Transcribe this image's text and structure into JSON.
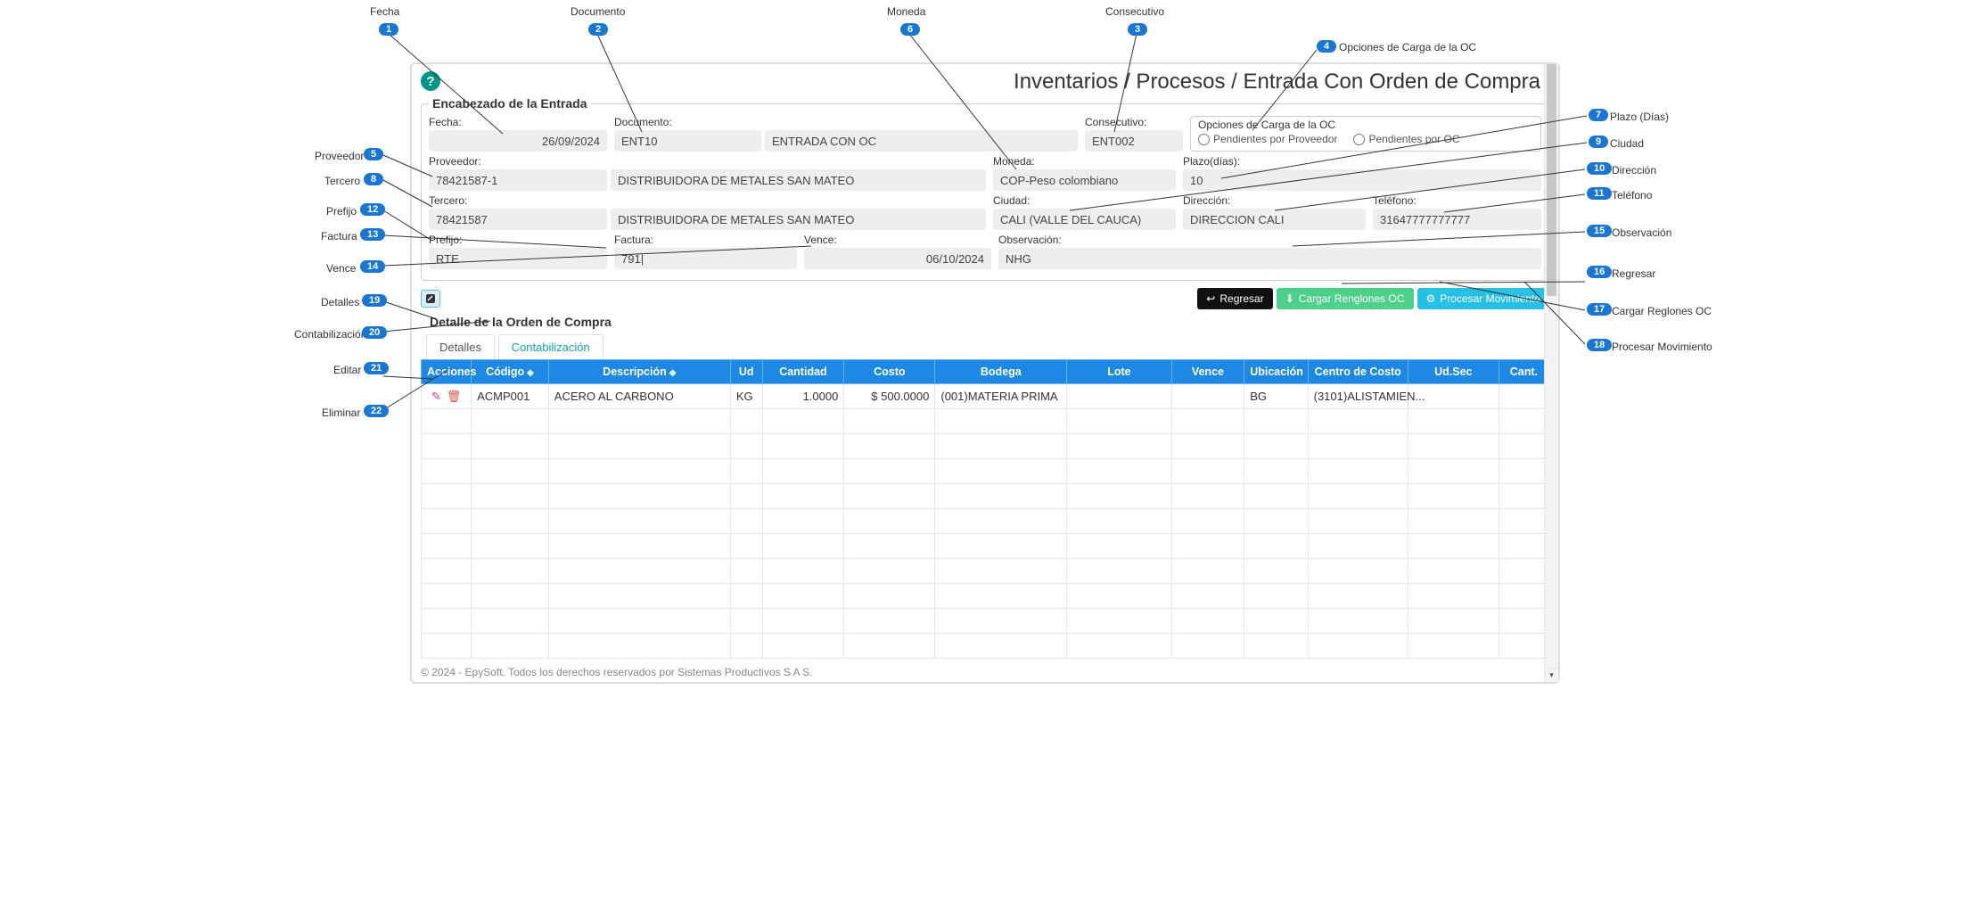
{
  "annotations": {
    "a1": {
      "num": "1",
      "label": "Fecha"
    },
    "a2": {
      "num": "2",
      "label": "Documento"
    },
    "a3": {
      "num": "3",
      "label": "Consecutivo"
    },
    "a4": {
      "num": "4",
      "label": "Opciones de Carga de la OC"
    },
    "a5": {
      "num": "5",
      "label": "Proveedor"
    },
    "a6": {
      "num": "6",
      "label": "Moneda"
    },
    "a7": {
      "num": "7",
      "label": "Plazo (Días)"
    },
    "a8": {
      "num": "8",
      "label": "Tercero"
    },
    "a9": {
      "num": "9",
      "label": "Ciudad"
    },
    "a10": {
      "num": "10",
      "label": "Dirección"
    },
    "a11": {
      "num": "11",
      "label": "Teléfono"
    },
    "a12": {
      "num": "12",
      "label": "Prefijo"
    },
    "a13": {
      "num": "13",
      "label": "Factura"
    },
    "a14": {
      "num": "14",
      "label": "Vence"
    },
    "a15": {
      "num": "15",
      "label": "Observación"
    },
    "a16": {
      "num": "16",
      "label": "Regresar"
    },
    "a17": {
      "num": "17",
      "label": "Cargar Reglones OC"
    },
    "a18": {
      "num": "18",
      "label": "Procesar Movimiento"
    },
    "a19": {
      "num": "19",
      "label": "Detalles"
    },
    "a20": {
      "num": "20",
      "label": "Contabilización"
    },
    "a21": {
      "num": "21",
      "label": "Editar"
    },
    "a22": {
      "num": "22",
      "label": "Eliminar"
    }
  },
  "breadcrumb": "Inventarios / Procesos / Entrada Con Orden de Compra",
  "header": {
    "legend": "Encabezado de la Entrada",
    "fecha": {
      "label": "Fecha:",
      "value": "26/09/2024"
    },
    "documento": {
      "label": "Documento:",
      "code": "ENT10",
      "desc": "ENTRADA CON OC"
    },
    "consecutivo": {
      "label": "Consecutivo:",
      "value": "ENT002"
    },
    "opciones": {
      "title": "Opciones de Carga de la OC",
      "opt1": "Pendientes por Proveedor",
      "opt2": "Pendientes por OC"
    },
    "proveedor": {
      "label": "Proveedor:",
      "code": "78421587-1",
      "name": "DISTRIBUIDORA DE METALES SAN MATEO"
    },
    "moneda": {
      "label": "Moneda:",
      "value": "COP-Peso colombiano"
    },
    "plazo": {
      "label": "Plazo(días):",
      "value": "10"
    },
    "tercero": {
      "label": "Tercero:",
      "code": "78421587",
      "name": "DISTRIBUIDORA DE METALES SAN MATEO"
    },
    "ciudad": {
      "label": "Ciudad:",
      "value": "CALI (VALLE DEL CAUCA)"
    },
    "direccion": {
      "label": "Dirección:",
      "value": "DIRECCION CALI"
    },
    "telefono": {
      "label": "Teléfono:",
      "value": "31647777777777"
    },
    "prefijo": {
      "label": "Prefijo:",
      "value": "RTE"
    },
    "factura": {
      "label": "Factura:",
      "value": "791|"
    },
    "vence": {
      "label": "Vence:",
      "value": "06/10/2024"
    },
    "observacion": {
      "label": "Observación:",
      "value": "NHG"
    }
  },
  "buttons": {
    "regresar": "Regresar",
    "cargar": "Cargar Renglones OC",
    "procesar": "Procesar Movimiento"
  },
  "detail": {
    "title": "Detalle de la Orden de Compra",
    "tabs": {
      "detalles": "Detalles",
      "contab": "Contabilización"
    },
    "cols": {
      "acciones": "Acciones",
      "codigo": "Código",
      "descripcion": "Descripción",
      "ud": "Ud",
      "cantidad": "Cantidad",
      "costo": "Costo",
      "bodega": "Bodega",
      "lote": "Lote",
      "vence": "Vence",
      "ubicacion": "Ubicación",
      "centro": "Centro de Costo",
      "udsec": "Ud.Sec",
      "cant": "Cant."
    },
    "rows": [
      {
        "codigo": "ACMP001",
        "descripcion": "ACERO AL CARBONO",
        "ud": "KG",
        "cantidad": "1.0000",
        "costo": "$ 500.0000",
        "bodega": "(001)MATERIA PRIMA",
        "lote": "",
        "vence": "",
        "ubicacion": "BG",
        "centro": "(3101)ALISTAMIEN...",
        "udsec": "",
        "cant": ""
      }
    ]
  },
  "footer": "© 2024 - EpySoft. Todos los derechos reservados por Sistemas Productivos S A S."
}
